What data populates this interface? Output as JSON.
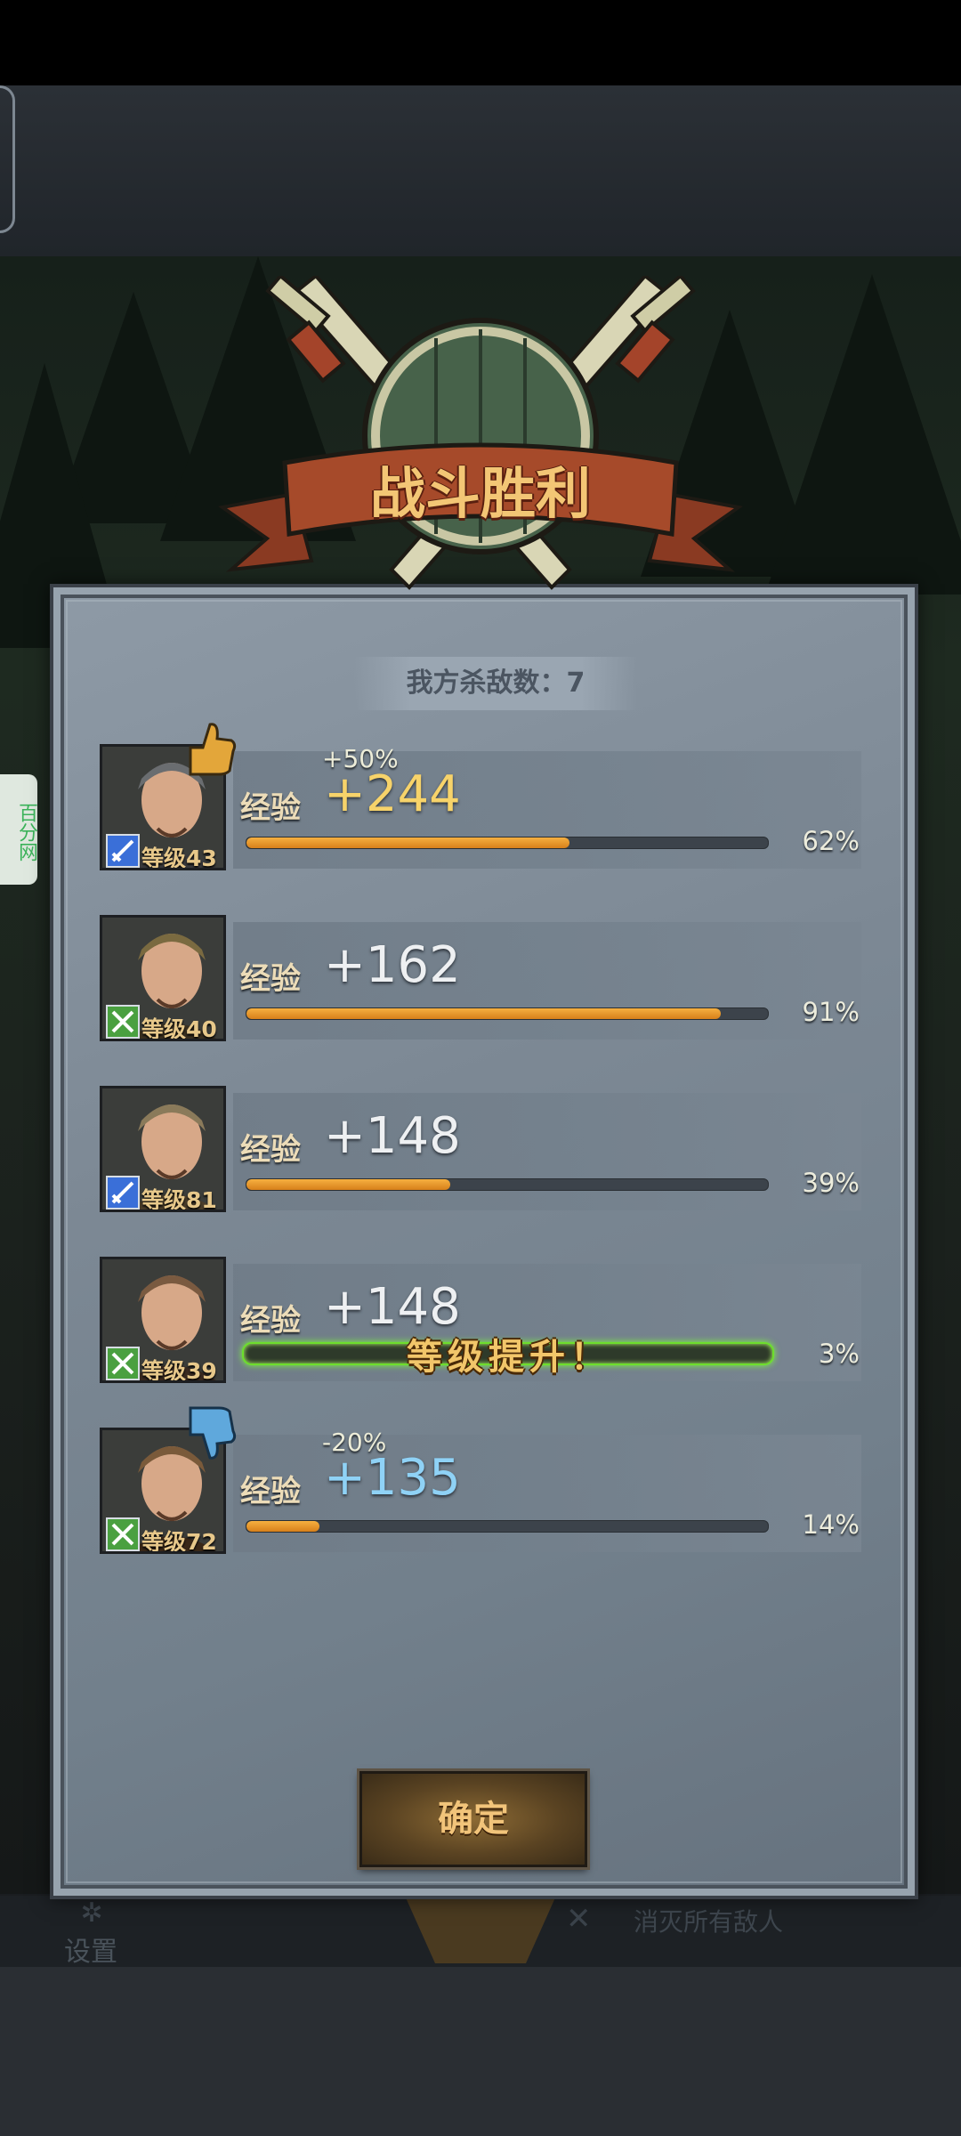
{
  "title": "战斗胜利",
  "kills": "我方杀敌数：7",
  "exp_label": "经验",
  "levelup_text": "等级提升！",
  "confirm_label": "确定",
  "side_tag": "百分网",
  "bottom_bar": {
    "settings_label": "设置",
    "extinguish_label": "消灭所有敌人"
  },
  "heroes": [
    {
      "level": "等级43",
      "exp": "+244",
      "bonus": "+50%",
      "percent": "62%",
      "progress": 0.62,
      "class": "sword",
      "badge": "thumbs-up",
      "exp_color": "#f7d36a"
    },
    {
      "level": "等级40",
      "exp": "+162",
      "bonus": "",
      "percent": "91%",
      "progress": 0.91,
      "class": "cross",
      "badge": "",
      "exp_color": "#eef0f2"
    },
    {
      "level": "等级81",
      "exp": "+148",
      "bonus": "",
      "percent": "39%",
      "progress": 0.39,
      "class": "sword",
      "badge": "",
      "exp_color": "#eef0f2"
    },
    {
      "level": "等级39",
      "exp": "+148",
      "bonus": "",
      "percent": "3%",
      "progress": 0.03,
      "class": "cross",
      "badge": "",
      "exp_color": "#eef0f2",
      "levelup": true
    },
    {
      "level": "等级72",
      "exp": "+135",
      "bonus": "-20%",
      "percent": "14%",
      "progress": 0.14,
      "class": "cross",
      "badge": "thumbs-down",
      "exp_color": "#8fd2f6"
    }
  ],
  "colors": {
    "accent_gold": "#f2c66a",
    "bar_fill": "#e8981e",
    "levelup_glow": "#6dde2c"
  }
}
